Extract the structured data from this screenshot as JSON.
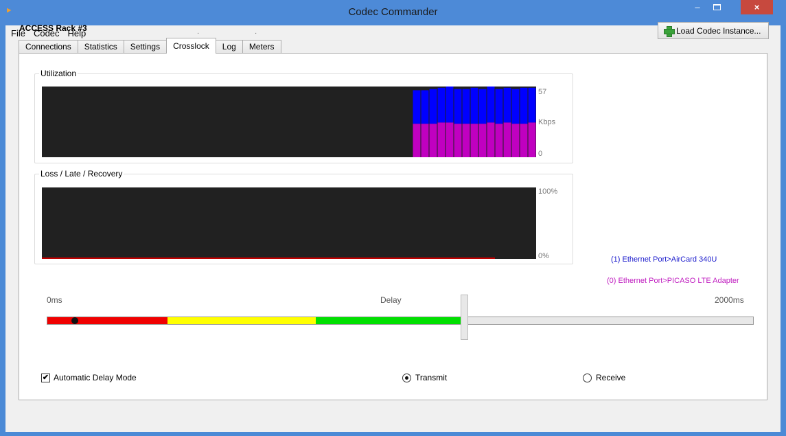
{
  "window": {
    "title": "Codec Commander",
    "close_label": "×",
    "minimize_label": "–"
  },
  "menu": [
    "File",
    "Codec",
    "Help"
  ],
  "rack_title": "ACCESS Rack #3",
  "load_button": "Load Codec Instance...",
  "tabs": [
    "Connections",
    "Statistics",
    "Settings",
    "Crosslock",
    "Log",
    "Meters"
  ],
  "active_tab": "Crosslock",
  "utilization": {
    "title": "Utilization",
    "axis_max": "57",
    "axis_unit": "Kbps",
    "axis_min": "0",
    "chart_data": {
      "type": "bar",
      "series": [
        {
          "name": "(1) Ethernet Port>AirCard 340U",
          "color": "#0000ff",
          "values": [
            27,
            27,
            28,
            28,
            29,
            28,
            28,
            29,
            28,
            29,
            28,
            28,
            28,
            29,
            28
          ]
        },
        {
          "name": "(0) Ethernet Port>PICASO LTE Adapter",
          "color": "#c000c0",
          "values": [
            27,
            27,
            27,
            28,
            28,
            27,
            27,
            27,
            27,
            28,
            27,
            28,
            27,
            27,
            28
          ]
        }
      ],
      "ylim": [
        0,
        57
      ],
      "total_slots": 60,
      "first_slot": 45
    }
  },
  "loss": {
    "title": "Loss / Late / Recovery",
    "axis_max": "100%",
    "axis_min": "0%",
    "chart_data": {
      "type": "line",
      "ylim": [
        0,
        100
      ],
      "series": [
        {
          "name": "loss",
          "color": "#c00000",
          "values": [
            0
          ]
        }
      ]
    }
  },
  "legend": {
    "item1": "(1) Ethernet Port>AirCard 340U",
    "item0": "(0) Ethernet Port>PICASO LTE Adapter"
  },
  "delay": {
    "min_label": "0ms",
    "center_label": "Delay",
    "max_label": "2000ms",
    "current_fraction": 0.04,
    "slider_fraction": 0.59
  },
  "auto_delay": {
    "label": "Automatic Delay Mode",
    "checked": true,
    "check_glyph": "✔"
  },
  "transmit": {
    "label": "Transmit",
    "selected": true
  },
  "receive": {
    "label": "Receive",
    "selected": false
  }
}
